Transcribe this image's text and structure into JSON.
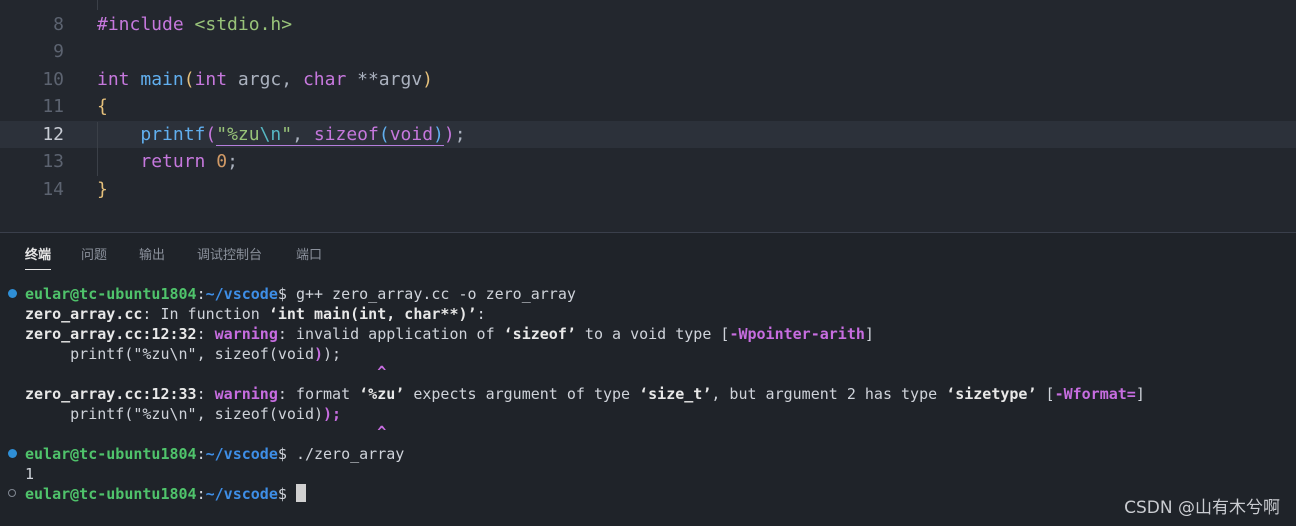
{
  "editor": {
    "lines": [
      {
        "num": "8"
      },
      {
        "num": "9"
      },
      {
        "num": "10"
      },
      {
        "num": "11"
      },
      {
        "num": "12"
      },
      {
        "num": "13"
      },
      {
        "num": "14"
      }
    ],
    "include": "#include",
    "include_header": "<stdio.h>",
    "int_kw": "int",
    "main_fn": "main",
    "paren_open": "(",
    "paren_close": ")",
    "int_kw2": "int",
    "argc": " argc, ",
    "char_kw": "char",
    "argv": " **argv",
    "brace_open": "{",
    "brace_close": "}",
    "printf": "printf",
    "str_q1": "\"%zu",
    "str_esc": "\\n",
    "str_q2": "\"",
    "comma": ", ",
    "sizeof": "sizeof",
    "void_kw": "void",
    "semicolon": ";",
    "return_kw": "return",
    "zero": "0"
  },
  "panel": {
    "tabs": [
      "终端",
      "问题",
      "输出",
      "调试控制台",
      "端口"
    ]
  },
  "terminal": {
    "prompt_user": "eular@tc-ubuntu1804",
    "prompt_sep": ":",
    "prompt_path": "~/vscode",
    "prompt_dollar": "$ ",
    "cmd1": "g++ zero_array.cc -o zero_array",
    "l2_file": "zero_array.cc",
    "l2_text": ": In function ",
    "l2_func": "‘int main(int, char**)’",
    "l2_end": ":",
    "l3_loc": "zero_array.cc:12:32",
    "l3_colon": ": ",
    "l3_warn": "warning",
    "l3_text": ": invalid application of ",
    "l3_sizeof": "‘sizeof’",
    "l3_text2": " to a void type [",
    "l3_flag": "-Wpointer-arith",
    "l3_end": "]",
    "l4_code": "     printf(\"%zu\\n\", sizeof(void",
    "l4_paren": ")",
    "l4_end": ");",
    "caret": "^",
    "l6_loc": "zero_array.cc:12:33",
    "l6_colon": ": ",
    "l6_warn": "warning",
    "l6_text": ": format ",
    "l6_fmt": "‘%zu’",
    "l6_text2": " expects argument of type ",
    "l6_type": "‘size_t’",
    "l6_text3": ", but argument 2 has type ",
    "l6_type2": "‘sizetype’",
    "l6_text4": " [",
    "l6_flag": "-Wformat=",
    "l6_end": "]",
    "l7_code": "     printf(\"%zu\\n\", sizeof(void)",
    "l7_end": ");",
    "cmd2": "./zero_array",
    "output": "1"
  },
  "watermark": "CSDN @山有木兮啊",
  "colors": {
    "background": "#23272e",
    "keyword": "#c678dd",
    "function": "#61afef",
    "string": "#98c379",
    "warning": "#c76de0",
    "prompt_user": "#4fc36b",
    "prompt_path": "#3e8ee6"
  }
}
